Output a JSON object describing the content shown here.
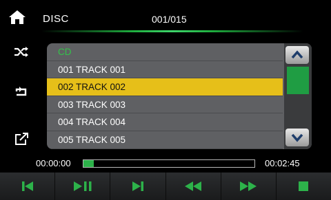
{
  "header": {
    "source": "DISC",
    "track_counter": "001/015"
  },
  "icons": {
    "home": "home-icon",
    "shuffle": "shuffle-icon",
    "repeat": "repeat-icon",
    "open": "open-external-icon"
  },
  "list": {
    "folder": "CD",
    "items": [
      {
        "label": "001 TRACK 001"
      },
      {
        "label": "002 TRACK 002",
        "selected": true
      },
      {
        "label": "003 TRACK 003"
      },
      {
        "label": "004 TRACK 004"
      },
      {
        "label": "005 TRACK 005"
      }
    ]
  },
  "progress": {
    "current_time": "00:00:00",
    "total_time": "00:02:45",
    "fraction": 0.06
  },
  "controls": [
    "previous-icon",
    "play-pause-icon",
    "next-icon",
    "rewind-icon",
    "fast-forward-icon",
    "stop-icon"
  ],
  "colors": {
    "accent": "#2db24a",
    "selected_row": "#e6bf19",
    "panel": "#5f6063"
  }
}
